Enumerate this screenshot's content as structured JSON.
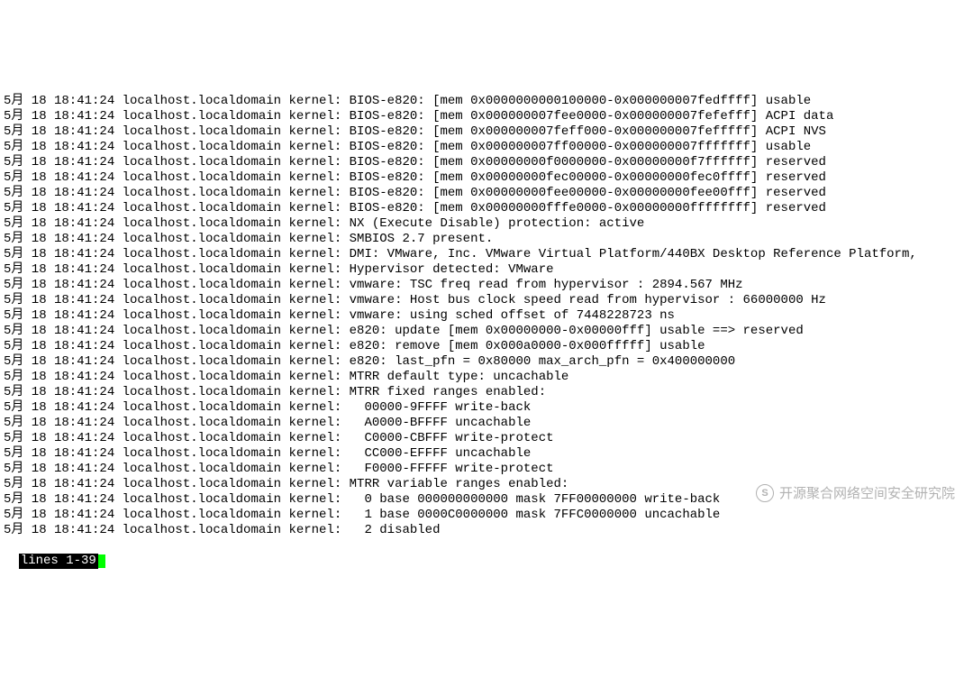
{
  "log_lines": [
    "5月 18 18:41:24 localhost.localdomain kernel: BIOS-e820: [mem 0x0000000000100000-0x000000007fedffff] usable",
    "5月 18 18:41:24 localhost.localdomain kernel: BIOS-e820: [mem 0x000000007fee0000-0x000000007fefefff] ACPI data",
    "5月 18 18:41:24 localhost.localdomain kernel: BIOS-e820: [mem 0x000000007feff000-0x000000007fefffff] ACPI NVS",
    "5月 18 18:41:24 localhost.localdomain kernel: BIOS-e820: [mem 0x000000007ff00000-0x000000007fffffff] usable",
    "5月 18 18:41:24 localhost.localdomain kernel: BIOS-e820: [mem 0x00000000f0000000-0x00000000f7ffffff] reserved",
    "5月 18 18:41:24 localhost.localdomain kernel: BIOS-e820: [mem 0x00000000fec00000-0x00000000fec0ffff] reserved",
    "5月 18 18:41:24 localhost.localdomain kernel: BIOS-e820: [mem 0x00000000fee00000-0x00000000fee00fff] reserved",
    "5月 18 18:41:24 localhost.localdomain kernel: BIOS-e820: [mem 0x00000000fffe0000-0x00000000ffffffff] reserved",
    "5月 18 18:41:24 localhost.localdomain kernel: NX (Execute Disable) protection: active",
    "5月 18 18:41:24 localhost.localdomain kernel: SMBIOS 2.7 present.",
    "5月 18 18:41:24 localhost.localdomain kernel: DMI: VMware, Inc. VMware Virtual Platform/440BX Desktop Reference Platform,",
    "5月 18 18:41:24 localhost.localdomain kernel: Hypervisor detected: VMware",
    "5月 18 18:41:24 localhost.localdomain kernel: vmware: TSC freq read from hypervisor : 2894.567 MHz",
    "5月 18 18:41:24 localhost.localdomain kernel: vmware: Host bus clock speed read from hypervisor : 66000000 Hz",
    "5月 18 18:41:24 localhost.localdomain kernel: vmware: using sched offset of 7448228723 ns",
    "5月 18 18:41:24 localhost.localdomain kernel: e820: update [mem 0x00000000-0x00000fff] usable ==> reserved",
    "5月 18 18:41:24 localhost.localdomain kernel: e820: remove [mem 0x000a0000-0x000fffff] usable",
    "5月 18 18:41:24 localhost.localdomain kernel: e820: last_pfn = 0x80000 max_arch_pfn = 0x400000000",
    "5月 18 18:41:24 localhost.localdomain kernel: MTRR default type: uncachable",
    "5月 18 18:41:24 localhost.localdomain kernel: MTRR fixed ranges enabled:",
    "5月 18 18:41:24 localhost.localdomain kernel:   00000-9FFFF write-back",
    "5月 18 18:41:24 localhost.localdomain kernel:   A0000-BFFFF uncachable",
    "5月 18 18:41:24 localhost.localdomain kernel:   C0000-CBFFF write-protect",
    "5月 18 18:41:24 localhost.localdomain kernel:   CC000-EFFFF uncachable",
    "5月 18 18:41:24 localhost.localdomain kernel:   F0000-FFFFF write-protect",
    "5月 18 18:41:24 localhost.localdomain kernel: MTRR variable ranges enabled:",
    "5月 18 18:41:24 localhost.localdomain kernel:   0 base 000000000000 mask 7FF00000000 write-back",
    "5月 18 18:41:24 localhost.localdomain kernel:   1 base 0000C0000000 mask 7FFC0000000 uncachable",
    "5月 18 18:41:24 localhost.localdomain kernel:   2 disabled"
  ],
  "status_text": "lines 1-39",
  "watermark_text": "开源聚合网络空间安全研究院",
  "watermark_icon_label": "S"
}
